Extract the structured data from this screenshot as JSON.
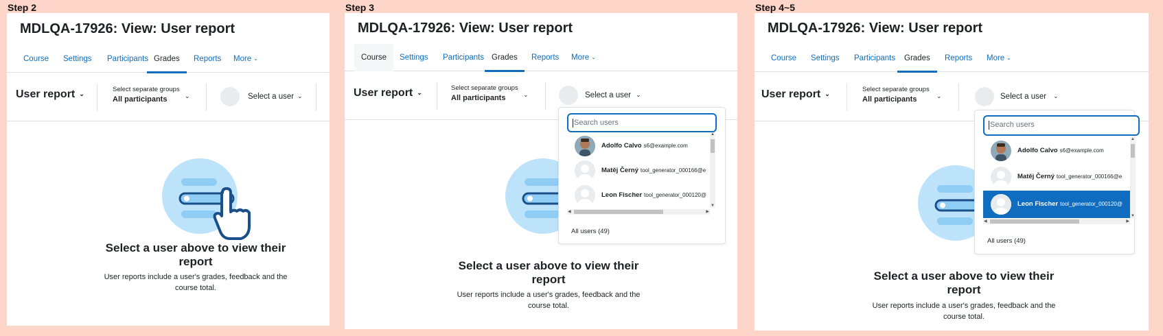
{
  "steps": [
    "Step 2",
    "Step 3",
    "Step 4~5"
  ],
  "page": {
    "title": "MDLQA-17926: View: User report",
    "nav": {
      "course": "Course",
      "settings": "Settings",
      "participants": "Participants",
      "grades": "Grades",
      "reports": "Reports",
      "more": "More"
    },
    "report_selector": "User report",
    "groups": {
      "label": "Select separate groups",
      "value": "All participants"
    },
    "user_selector": "Select a user",
    "empty_title_line1": "Select a user above to view their",
    "empty_title_line2": "report",
    "empty_sub_line1": "User reports include a user's grades, feedback and the",
    "empty_sub_line2": "course total."
  },
  "dropdown": {
    "search_placeholder": "Search users",
    "users": [
      {
        "name": "Adolfo Calvo",
        "email": "s6@example.com"
      },
      {
        "name": "Matěj Černý",
        "email": "tool_generator_000166@e"
      },
      {
        "name": "Leon Fischer",
        "email": "tool_generator_000120@"
      }
    ],
    "all_users": "All users (49)"
  },
  "colors": {
    "accent": "#0f6cbf",
    "background": "#fdd5c9",
    "illustration": "#bde3fb"
  },
  "icons": {
    "caret": "chevron-down-icon",
    "illustration": "pointer-hand-icon"
  }
}
